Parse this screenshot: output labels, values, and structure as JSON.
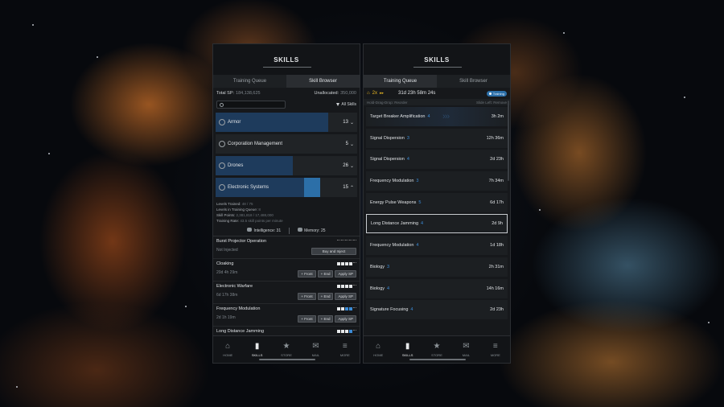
{
  "left": {
    "title": "SKILLS",
    "tabs": {
      "queue": "Training Queue",
      "browser": "Skill Browser"
    },
    "total_sp_label": "Total SP:",
    "total_sp_value": "184,138,625",
    "unallocated_label": "Unallocated:",
    "unallocated_value": "350,000",
    "filter_label": "All Skills",
    "categories": [
      {
        "name": "Armor",
        "count": "13"
      },
      {
        "name": "Corporation Management",
        "count": "5"
      },
      {
        "name": "Drones",
        "count": "26"
      },
      {
        "name": "Electronic Systems",
        "count": "15"
      }
    ],
    "group_info": {
      "levels_trained_label": "Levels Trained:",
      "levels_trained_value": "48 / 75",
      "levels_queue_label": "Levels in Training Queue:",
      "levels_queue_value": "8",
      "skill_points_label": "Skill Points:",
      "skill_points_value": "2,381,818 / 17,488,000",
      "training_rate_label": "Training Rate:",
      "training_rate_value": "43.5 skill points per minute"
    },
    "attributes": {
      "primary": "Intelligence: 31",
      "secondary": "Memory: 25"
    },
    "skills": [
      {
        "name": "Burst Projector Operation",
        "sub": "Not Injected",
        "action": "Buy and Inject"
      },
      {
        "name": "Cloaking",
        "sub": "20d 4h 29m",
        "front": "+ Front",
        "end": "+ End",
        "apply": "Apply SP"
      },
      {
        "name": "Electronic Warfare",
        "sub": "6d 17h 38m",
        "front": "+ Front",
        "end": "+ End",
        "apply": "Apply SP"
      },
      {
        "name": "Frequency Modulation",
        "sub": "2d 1h 19m",
        "front": "+ Front",
        "end": "+ End",
        "apply": "Apply SP"
      },
      {
        "name": "Long Distance Jamming",
        "sub": ""
      }
    ]
  },
  "right": {
    "title": "SKILLS",
    "tabs": {
      "queue": "Training Queue",
      "browser": "Skill Browser"
    },
    "multiplier": "2x",
    "total_time": "31d 23h 58m 24s",
    "status_badge": "Training",
    "hint_left": "Hold-Drag-Drop: Reorder",
    "hint_right": "Slide Left: Remove",
    "queue": [
      {
        "name": "Target Breaker Amplification",
        "level": "4",
        "time": "3h 2m"
      },
      {
        "name": "Signal Dispersion",
        "level": "3",
        "time": "12h 36m"
      },
      {
        "name": "Signal Dispersion",
        "level": "4",
        "time": "2d 23h"
      },
      {
        "name": "Frequency Modulation",
        "level": "3",
        "time": "7h 34m"
      },
      {
        "name": "Energy Pulse Weapons",
        "level": "5",
        "time": "6d 17h"
      },
      {
        "name": "Long Distance Jamming",
        "level": "4",
        "time": "2d 9h"
      },
      {
        "name": "Frequency Modulation",
        "level": "4",
        "time": "1d 18h"
      },
      {
        "name": "Biology",
        "level": "3",
        "time": "2h 31m"
      },
      {
        "name": "Biology",
        "level": "4",
        "time": "14h 16m"
      },
      {
        "name": "Signature Focusing",
        "level": "4",
        "time": "2d 23h"
      }
    ]
  },
  "nav": {
    "home": "HOME",
    "skills": "SKILLS",
    "store": "STORE",
    "mail": "MAIL",
    "more": "MORE"
  },
  "colors": {
    "accent_blue": "#2c6fa8",
    "gold": "#e6b422",
    "panel": "#16181b"
  }
}
